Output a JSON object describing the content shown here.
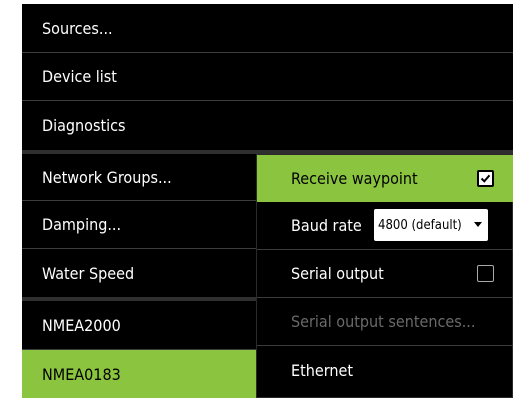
{
  "left_menu": {
    "items": [
      {
        "label": "Sources..."
      },
      {
        "label": "Device list"
      },
      {
        "label": "Diagnostics"
      },
      {
        "label": "Network Groups..."
      },
      {
        "label": "Damping..."
      },
      {
        "label": "Water Speed"
      },
      {
        "label": "NMEA2000"
      },
      {
        "label": "NMEA0183"
      }
    ]
  },
  "sub_menu": {
    "receive_waypoint": {
      "label": "Receive waypoint",
      "checked": true
    },
    "baud_rate": {
      "label": "Baud rate",
      "value": "4800 (default)"
    },
    "serial_output": {
      "label": "Serial output",
      "checked": false
    },
    "serial_output_sentences": {
      "label": "Serial output sentences..."
    },
    "ethernet": {
      "label": "Ethernet"
    }
  },
  "colors": {
    "accent": "#8bc53f",
    "background": "#000000",
    "text": "#ffffff",
    "disabled_text": "#6a6a6a"
  }
}
